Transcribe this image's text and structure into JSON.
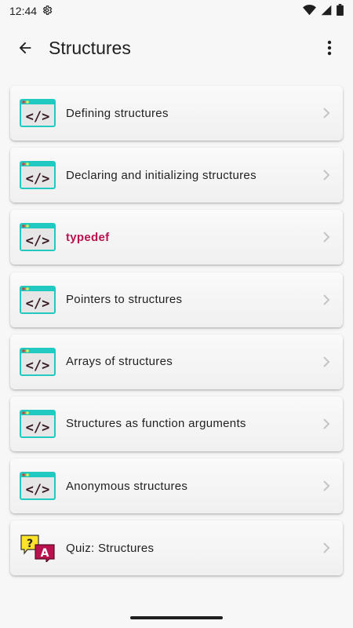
{
  "status_bar": {
    "time": "12:44"
  },
  "app_bar": {
    "title": "Structures"
  },
  "colors": {
    "accent": "#b8124f",
    "code_icon_teal": "#22c9c0",
    "code_icon_fill": "#e6e6e6"
  },
  "items": [
    {
      "label": "Defining structures",
      "icon": "code-icon",
      "highlight": false
    },
    {
      "label": "Declaring and initializing structures",
      "icon": "code-icon",
      "highlight": false
    },
    {
      "label": "typedef",
      "icon": "code-icon",
      "highlight": true
    },
    {
      "label": "Pointers to structures",
      "icon": "code-icon",
      "highlight": false
    },
    {
      "label": "Arrays of structures",
      "icon": "code-icon",
      "highlight": false
    },
    {
      "label": "Structures as function arguments",
      "icon": "code-icon",
      "highlight": false
    },
    {
      "label": "Anonymous structures",
      "icon": "code-icon",
      "highlight": false
    },
    {
      "label": "Quiz: Structures",
      "icon": "quiz-icon",
      "highlight": false
    }
  ]
}
